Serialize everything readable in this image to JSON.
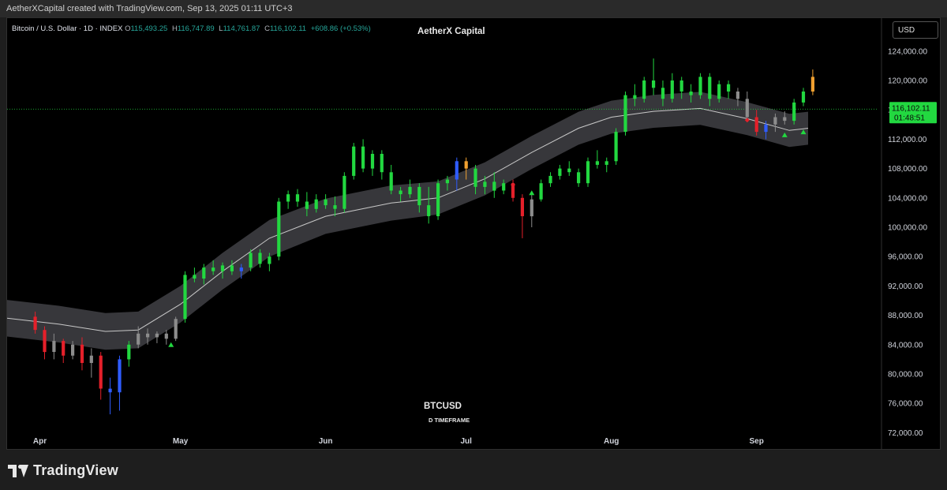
{
  "header": {
    "caption": "AetherXCapital created with TradingView.com, Sep 13, 2025 01:11 UTC+3"
  },
  "chart": {
    "symbol_title": "Bitcoin / U.S. Dollar · 1D · INDEX",
    "ohlc": [
      {
        "key": "O",
        "value": "115,493.25"
      },
      {
        "key": "H",
        "value": "116,747.89"
      },
      {
        "key": "L",
        "value": "114,761.87"
      },
      {
        "key": "C",
        "value": "116,102.11"
      }
    ],
    "change": "+608.86 (+0.53%)",
    "center_title": "AetherX Capital",
    "currency": "USD",
    "price_label": "116,102.11",
    "countdown": "01:48:51",
    "bottom_symbol": "BTCUSD",
    "bottom_subtitle": "D TIMEFRAME"
  },
  "colors": {
    "up": "#22d840",
    "down": "#e5202a",
    "neutral": "#8c8c8c",
    "blue": "#2f5cff",
    "orange": "#f0a030",
    "band": "#3a3a3e",
    "midline": "#c8c8c8",
    "price_line": "#22d840"
  },
  "footer": {
    "logo_text": "TradingView"
  },
  "chart_data": {
    "type": "candlestick",
    "y_ticks": [
      "72,000.00",
      "76,000.00",
      "80,000.00",
      "84,000.00",
      "88,000.00",
      "92,000.00",
      "96,000.00",
      "100,000.00",
      "104,000.00",
      "108,000.00",
      "112,000.00",
      "116,000.00",
      "120,000.00",
      "124,000.00"
    ],
    "y_tick_values": [
      72000,
      76000,
      80000,
      84000,
      88000,
      92000,
      96000,
      100000,
      104000,
      108000,
      112000,
      116000,
      120000,
      124000
    ],
    "ylim": [
      71500,
      128500
    ],
    "x_ticks": [
      {
        "label": "Apr",
        "date": "2025-04-01"
      },
      {
        "label": "May",
        "date": "2025-05-01"
      },
      {
        "label": "Jun",
        "date": "2025-06-01"
      },
      {
        "label": "Jul",
        "date": "2025-07-01"
      },
      {
        "label": "Aug",
        "date": "2025-08-01"
      },
      {
        "label": "Sep",
        "date": "2025-09-01"
      }
    ],
    "xlim": [
      "2025-03-25",
      "2025-09-27"
    ],
    "last_close": 116102.11,
    "bands": [
      {
        "date": "2025-03-25",
        "mid": 87600,
        "width": 5000
      },
      {
        "date": "2025-04-05",
        "mid": 86800,
        "width": 5000
      },
      {
        "date": "2025-04-15",
        "mid": 85800,
        "width": 5000
      },
      {
        "date": "2025-04-22",
        "mid": 86000,
        "width": 5000
      },
      {
        "date": "2025-05-01",
        "mid": 89500,
        "width": 5000
      },
      {
        "date": "2025-05-10",
        "mid": 94000,
        "width": 5000
      },
      {
        "date": "2025-05-20",
        "mid": 98500,
        "width": 5000
      },
      {
        "date": "2025-06-01",
        "mid": 101500,
        "width": 4800
      },
      {
        "date": "2025-06-15",
        "mid": 103300,
        "width": 4800
      },
      {
        "date": "2025-06-25",
        "mid": 104000,
        "width": 4500
      },
      {
        "date": "2025-07-05",
        "mid": 106600,
        "width": 4500
      },
      {
        "date": "2025-07-15",
        "mid": 110200,
        "width": 4500
      },
      {
        "date": "2025-07-25",
        "mid": 113500,
        "width": 4500
      },
      {
        "date": "2025-08-01",
        "mid": 115000,
        "width": 4500
      },
      {
        "date": "2025-08-10",
        "mid": 115800,
        "width": 4500
      },
      {
        "date": "2025-08-20",
        "mid": 116200,
        "width": 4500
      },
      {
        "date": "2025-08-30",
        "mid": 114800,
        "width": 4500
      },
      {
        "date": "2025-09-08",
        "mid": 113200,
        "width": 4500
      },
      {
        "date": "2025-09-12",
        "mid": 113500,
        "width": 4500
      }
    ],
    "candles": [
      {
        "date": "2025-03-31",
        "o": 87800,
        "h": 88500,
        "l": 85500,
        "c": 86000,
        "color": "down"
      },
      {
        "date": "2025-04-02",
        "o": 86000,
        "h": 86500,
        "l": 82000,
        "c": 83000,
        "color": "down"
      },
      {
        "date": "2025-04-04",
        "o": 83000,
        "h": 85500,
        "l": 82000,
        "c": 84500,
        "color": "neutral"
      },
      {
        "date": "2025-04-06",
        "o": 84500,
        "h": 84800,
        "l": 81500,
        "c": 82500,
        "color": "down"
      },
      {
        "date": "2025-04-08",
        "o": 82500,
        "h": 84500,
        "l": 82000,
        "c": 84000,
        "color": "neutral"
      },
      {
        "date": "2025-04-10",
        "o": 84000,
        "h": 85000,
        "l": 80500,
        "c": 81500,
        "color": "down"
      },
      {
        "date": "2025-04-12",
        "o": 81500,
        "h": 83500,
        "l": 79500,
        "c": 82500,
        "color": "neutral"
      },
      {
        "date": "2025-04-14",
        "o": 82500,
        "h": 83000,
        "l": 76500,
        "c": 78000,
        "color": "down"
      },
      {
        "date": "2025-04-16",
        "o": 78000,
        "h": 79500,
        "l": 74500,
        "c": 77500,
        "color": "blue"
      },
      {
        "date": "2025-04-18",
        "o": 77500,
        "h": 82500,
        "l": 75000,
        "c": 82000,
        "color": "blue"
      },
      {
        "date": "2025-04-20",
        "o": 82000,
        "h": 84500,
        "l": 81000,
        "c": 84000,
        "color": "up"
      },
      {
        "date": "2025-04-22",
        "o": 84000,
        "h": 86500,
        "l": 83500,
        "c": 85500,
        "color": "neutral"
      },
      {
        "date": "2025-04-24",
        "o": 85500,
        "h": 86200,
        "l": 84000,
        "c": 85000,
        "color": "neutral"
      },
      {
        "date": "2025-04-26",
        "o": 85000,
        "h": 85800,
        "l": 84200,
        "c": 85500,
        "color": "neutral"
      },
      {
        "date": "2025-04-28",
        "o": 85500,
        "h": 86000,
        "l": 84000,
        "c": 84800,
        "color": "neutral"
      },
      {
        "date": "2025-04-30",
        "o": 84800,
        "h": 87800,
        "l": 84500,
        "c": 87500,
        "color": "neutral"
      },
      {
        "date": "2025-05-02",
        "o": 87500,
        "h": 94000,
        "l": 87000,
        "c": 93500,
        "color": "up"
      },
      {
        "date": "2025-05-04",
        "o": 93500,
        "h": 94500,
        "l": 92500,
        "c": 93000,
        "color": "up"
      },
      {
        "date": "2025-05-06",
        "o": 93000,
        "h": 95000,
        "l": 92200,
        "c": 94500,
        "color": "up"
      },
      {
        "date": "2025-05-08",
        "o": 94500,
        "h": 95500,
        "l": 93500,
        "c": 94000,
        "color": "up"
      },
      {
        "date": "2025-05-10",
        "o": 94000,
        "h": 95200,
        "l": 93000,
        "c": 94800,
        "color": "up"
      },
      {
        "date": "2025-05-12",
        "o": 94800,
        "h": 95500,
        "l": 93500,
        "c": 94000,
        "color": "up"
      },
      {
        "date": "2025-05-14",
        "o": 94000,
        "h": 95000,
        "l": 93000,
        "c": 94500,
        "color": "blue"
      },
      {
        "date": "2025-05-16",
        "o": 94500,
        "h": 97000,
        "l": 94000,
        "c": 96500,
        "color": "up"
      },
      {
        "date": "2025-05-18",
        "o": 96500,
        "h": 97000,
        "l": 94500,
        "c": 95000,
        "color": "up"
      },
      {
        "date": "2025-05-20",
        "o": 95000,
        "h": 96500,
        "l": 94000,
        "c": 96000,
        "color": "up"
      },
      {
        "date": "2025-05-22",
        "o": 96000,
        "h": 104000,
        "l": 95500,
        "c": 103500,
        "color": "up"
      },
      {
        "date": "2025-05-24",
        "o": 103500,
        "h": 105000,
        "l": 102500,
        "c": 104500,
        "color": "up"
      },
      {
        "date": "2025-05-26",
        "o": 104500,
        "h": 105200,
        "l": 102800,
        "c": 103500,
        "color": "up"
      },
      {
        "date": "2025-05-28",
        "o": 103500,
        "h": 104800,
        "l": 101500,
        "c": 102500,
        "color": "up"
      },
      {
        "date": "2025-05-30",
        "o": 102500,
        "h": 104500,
        "l": 102000,
        "c": 103800,
        "color": "up"
      },
      {
        "date": "2025-06-01",
        "o": 103800,
        "h": 104500,
        "l": 102500,
        "c": 103000,
        "color": "up"
      },
      {
        "date": "2025-06-03",
        "o": 103000,
        "h": 104200,
        "l": 101500,
        "c": 102500,
        "color": "up"
      },
      {
        "date": "2025-06-05",
        "o": 102500,
        "h": 107500,
        "l": 102000,
        "c": 107000,
        "color": "up"
      },
      {
        "date": "2025-06-07",
        "o": 107000,
        "h": 111500,
        "l": 106500,
        "c": 111000,
        "color": "up"
      },
      {
        "date": "2025-06-09",
        "o": 111000,
        "h": 112000,
        "l": 107500,
        "c": 108000,
        "color": "up"
      },
      {
        "date": "2025-06-11",
        "o": 108000,
        "h": 110500,
        "l": 107000,
        "c": 110000,
        "color": "up"
      },
      {
        "date": "2025-06-13",
        "o": 110000,
        "h": 110500,
        "l": 106500,
        "c": 107500,
        "color": "up"
      },
      {
        "date": "2025-06-15",
        "o": 107500,
        "h": 108500,
        "l": 104500,
        "c": 105000,
        "color": "up"
      },
      {
        "date": "2025-06-17",
        "o": 105000,
        "h": 105500,
        "l": 103500,
        "c": 104500,
        "color": "up"
      },
      {
        "date": "2025-06-19",
        "o": 104500,
        "h": 106500,
        "l": 104000,
        "c": 105500,
        "color": "up"
      },
      {
        "date": "2025-06-21",
        "o": 105500,
        "h": 106000,
        "l": 102000,
        "c": 103000,
        "color": "up"
      },
      {
        "date": "2025-06-23",
        "o": 103000,
        "h": 105500,
        "l": 100500,
        "c": 101500,
        "color": "up"
      },
      {
        "date": "2025-06-25",
        "o": 101500,
        "h": 106500,
        "l": 101000,
        "c": 106000,
        "color": "up"
      },
      {
        "date": "2025-06-27",
        "o": 106000,
        "h": 107000,
        "l": 105000,
        "c": 106500,
        "color": "up"
      },
      {
        "date": "2025-06-29",
        "o": 106500,
        "h": 109500,
        "l": 105000,
        "c": 109000,
        "color": "blue"
      },
      {
        "date": "2025-07-01",
        "o": 109000,
        "h": 109500,
        "l": 106500,
        "c": 108000,
        "color": "orange"
      },
      {
        "date": "2025-07-03",
        "o": 108000,
        "h": 108500,
        "l": 104500,
        "c": 105500,
        "color": "up"
      },
      {
        "date": "2025-07-05",
        "o": 105500,
        "h": 107000,
        "l": 104500,
        "c": 106200,
        "color": "up"
      },
      {
        "date": "2025-07-07",
        "o": 106200,
        "h": 107500,
        "l": 104000,
        "c": 105000,
        "color": "up"
      },
      {
        "date": "2025-07-09",
        "o": 105000,
        "h": 106500,
        "l": 104500,
        "c": 106000,
        "color": "up"
      },
      {
        "date": "2025-07-11",
        "o": 106000,
        "h": 106500,
        "l": 103500,
        "c": 104000,
        "color": "down"
      },
      {
        "date": "2025-07-13",
        "o": 104000,
        "h": 104500,
        "l": 98500,
        "c": 101500,
        "color": "down"
      },
      {
        "date": "2025-07-15",
        "o": 101500,
        "h": 104500,
        "l": 100000,
        "c": 103800,
        "color": "neutral"
      },
      {
        "date": "2025-07-17",
        "o": 103800,
        "h": 106500,
        "l": 103500,
        "c": 106000,
        "color": "up"
      },
      {
        "date": "2025-07-19",
        "o": 106000,
        "h": 107500,
        "l": 105500,
        "c": 107000,
        "color": "up"
      },
      {
        "date": "2025-07-21",
        "o": 107000,
        "h": 108500,
        "l": 106500,
        "c": 108000,
        "color": "up"
      },
      {
        "date": "2025-07-23",
        "o": 108000,
        "h": 109000,
        "l": 107000,
        "c": 107500,
        "color": "up"
      },
      {
        "date": "2025-07-25",
        "o": 107500,
        "h": 108000,
        "l": 105500,
        "c": 106000,
        "color": "up"
      },
      {
        "date": "2025-07-27",
        "o": 106000,
        "h": 109500,
        "l": 105500,
        "c": 109000,
        "color": "up"
      },
      {
        "date": "2025-07-29",
        "o": 109000,
        "h": 110500,
        "l": 108000,
        "c": 108500,
        "color": "up"
      },
      {
        "date": "2025-07-31",
        "o": 108500,
        "h": 109500,
        "l": 107500,
        "c": 109000,
        "color": "up"
      },
      {
        "date": "2025-08-02",
        "o": 109000,
        "h": 113500,
        "l": 108500,
        "c": 113000,
        "color": "up"
      },
      {
        "date": "2025-08-04",
        "o": 113000,
        "h": 118500,
        "l": 112500,
        "c": 118000,
        "color": "up"
      },
      {
        "date": "2025-08-06",
        "o": 118000,
        "h": 119500,
        "l": 116500,
        "c": 117500,
        "color": "up"
      },
      {
        "date": "2025-08-08",
        "o": 117500,
        "h": 120500,
        "l": 117000,
        "c": 120000,
        "color": "up"
      },
      {
        "date": "2025-08-10",
        "o": 120000,
        "h": 123000,
        "l": 118000,
        "c": 119000,
        "color": "up"
      },
      {
        "date": "2025-08-12",
        "o": 119000,
        "h": 120000,
        "l": 116500,
        "c": 117500,
        "color": "up"
      },
      {
        "date": "2025-08-14",
        "o": 117500,
        "h": 121000,
        "l": 117000,
        "c": 120000,
        "color": "up"
      },
      {
        "date": "2025-08-16",
        "o": 120000,
        "h": 120500,
        "l": 117500,
        "c": 118500,
        "color": "up"
      },
      {
        "date": "2025-08-18",
        "o": 118500,
        "h": 119500,
        "l": 117000,
        "c": 118000,
        "color": "up"
      },
      {
        "date": "2025-08-20",
        "o": 118000,
        "h": 121000,
        "l": 117500,
        "c": 120500,
        "color": "up"
      },
      {
        "date": "2025-08-22",
        "o": 120500,
        "h": 121000,
        "l": 116500,
        "c": 117500,
        "color": "up"
      },
      {
        "date": "2025-08-24",
        "o": 117500,
        "h": 120000,
        "l": 117000,
        "c": 119500,
        "color": "up"
      },
      {
        "date": "2025-08-26",
        "o": 119500,
        "h": 120000,
        "l": 117500,
        "c": 118500,
        "color": "up"
      },
      {
        "date": "2025-08-28",
        "o": 118500,
        "h": 119000,
        "l": 116500,
        "c": 117500,
        "color": "neutral"
      },
      {
        "date": "2025-08-30",
        "o": 117500,
        "h": 118500,
        "l": 114500,
        "c": 115000,
        "color": "neutral"
      },
      {
        "date": "2025-09-01",
        "o": 115000,
        "h": 116000,
        "l": 112500,
        "c": 113000,
        "color": "down"
      },
      {
        "date": "2025-09-03",
        "o": 113000,
        "h": 114500,
        "l": 112000,
        "c": 114000,
        "color": "blue"
      },
      {
        "date": "2025-09-05",
        "o": 114000,
        "h": 115500,
        "l": 113000,
        "c": 115000,
        "color": "neutral"
      },
      {
        "date": "2025-09-07",
        "o": 115000,
        "h": 115800,
        "l": 114000,
        "c": 114500,
        "color": "neutral"
      },
      {
        "date": "2025-09-09",
        "o": 114500,
        "h": 117500,
        "l": 114000,
        "c": 117000,
        "color": "up"
      },
      {
        "date": "2025-09-11",
        "o": 117000,
        "h": 119000,
        "l": 116500,
        "c": 118500,
        "color": "up"
      },
      {
        "date": "2025-09-13",
        "o": 118500,
        "h": 121500,
        "l": 118000,
        "c": 120500,
        "color": "orange"
      }
    ]
  }
}
